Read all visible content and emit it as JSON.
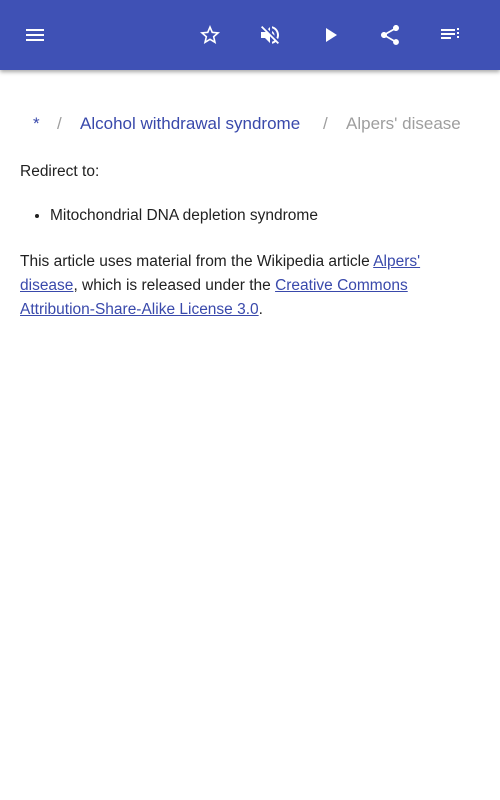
{
  "appbar": {
    "menu_icon": "hamburger-menu-icon",
    "star_icon": "star-outline-icon",
    "mute_icon": "volume-off-icon",
    "play_icon": "play-icon",
    "share_icon": "share-icon",
    "list_icon": "playlist-icon",
    "background_color": "#3f51b5"
  },
  "breadcrumb": {
    "home": "*",
    "separator": "/",
    "parent": "Alcohol withdrawal syndrome",
    "current": "Alpers' disease"
  },
  "article": {
    "redirect_label": "Redirect to:",
    "redirect_items": [
      "Mitochondrial DNA depletion syndrome"
    ],
    "attribution": {
      "prefix": "This article uses material from the Wikipedia article ",
      "article_link": "Alpers' disease",
      "middle": ", which is released under the ",
      "license_link": "Creative Commons Attribution-Share-Alike License 3.0",
      "suffix": "."
    }
  },
  "colors": {
    "link": "#3949ab",
    "muted": "#9e9e9e",
    "text": "#212121"
  }
}
